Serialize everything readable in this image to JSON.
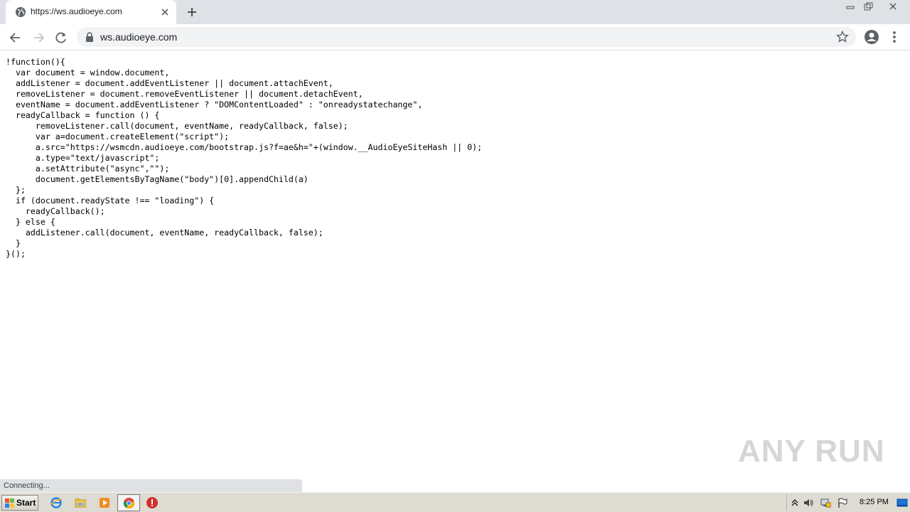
{
  "browser": {
    "tab": {
      "title": "https://ws.audioeye.com"
    },
    "omnibox": {
      "url": "ws.audioeye.com"
    },
    "status": "Connecting..."
  },
  "page": {
    "code_lines": [
      "!function(){",
      "  var document = window.document,",
      "  addListener = document.addEventListener || document.attachEvent,",
      "  removeListener = document.removeEventListener || document.detachEvent,",
      "  eventName = document.addEventListener ? \"DOMContentLoaded\" : \"onreadystatechange\",",
      "  readyCallback = function () {",
      "      removeListener.call(document, eventName, readyCallback, false);",
      "      var a=document.createElement(\"script\");",
      "      a.src=\"https://wsmcdn.audioeye.com/bootstrap.js?f=ae&h=\"+(window.__AudioEyeSiteHash || 0);",
      "      a.type=\"text/javascript\";",
      "      a.setAttribute(\"async\",\"\");",
      "      document.getElementsByTagName(\"body\")[0].appendChild(a)",
      "  };",
      "  if (document.readyState !== \"loading\") {",
      "    readyCallback();",
      "  } else {",
      "    addListener.call(document, eventName, readyCallback, false);",
      "  }",
      "}();"
    ]
  },
  "watermark": "ANY RUN",
  "taskbar": {
    "start_label": "Start",
    "clock": "8:25 PM"
  },
  "colors": {
    "tabstrip": "#dee1e6",
    "omnibox": "#f1f3f4",
    "taskbar": "#dedbd2"
  }
}
